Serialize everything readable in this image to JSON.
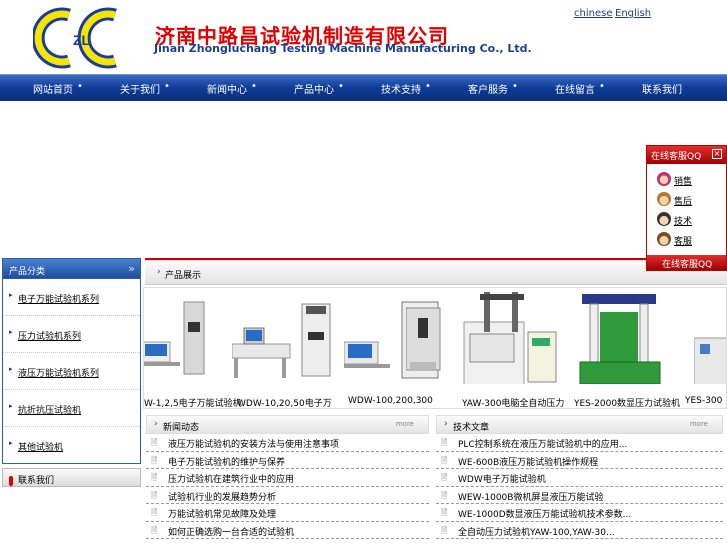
{
  "header": {
    "logo_text": "ZL",
    "company_cn": "济南中路昌试验机制造有限公司",
    "company_en": "Jinan Zhongluchang Testing Machine Manufacturing Co., Ltd.",
    "lang_cn": "chinese",
    "lang_en": "English"
  },
  "nav": {
    "items": [
      "网站首页",
      "关于我们",
      "新闻中心",
      "产品中心",
      "技术支持",
      "客户服务",
      "在线留言",
      "联系我们"
    ],
    "separator": "•"
  },
  "sidebar": {
    "title": "产品分类",
    "arrows": "»",
    "items": [
      "电子万能试验机系列",
      "压力试验机系列",
      "液压万能试验机系列",
      "抗折抗压试验机",
      "其他试验机"
    ],
    "contact_title": "联系我们"
  },
  "products": {
    "title": "产品展示",
    "items": [
      {
        "caption": "W-1,2,5电子万能试验机"
      },
      {
        "caption": "WDW-10,20,50电子万"
      },
      {
        "caption": "WDW-100,200,300"
      },
      {
        "caption": "YAW-300电脑全自动压力"
      },
      {
        "caption": "YES-2000数显压力试验机"
      },
      {
        "caption": "YES-300"
      }
    ]
  },
  "news": {
    "title": "新闻动态",
    "more": "more",
    "items": [
      "液压万能试验机的安装方法与使用注意事项",
      "电子万能试验机的维护与保养",
      "压力试验机在建筑行业中的应用",
      "试验机行业的发展趋势分析",
      "万能试验机常见故障及处理",
      "如何正确选购一台合适的试验机"
    ]
  },
  "tech": {
    "title": "技术文章",
    "more": "more",
    "items": [
      "PLC控制系统在液压万能试验机中的应用...",
      "WE-600B液压万能试验机操作规程",
      "WDW电子万能试验机",
      "WEW-1000B微机屏显液压万能试验",
      "WE-1000D数显液压万能试验机技术参数...",
      "全自动压力试验机YAW-100,YAW-30..."
    ]
  },
  "qq": {
    "title": "在线客服QQ",
    "close": "×",
    "agents": [
      "销售",
      "售后",
      "技术",
      "客服"
    ],
    "footer": "在线客服QQ"
  },
  "colors": {
    "nav_blue": "#0e3b95",
    "title_red": "#e00000",
    "brand_blue": "#1c3f94"
  }
}
